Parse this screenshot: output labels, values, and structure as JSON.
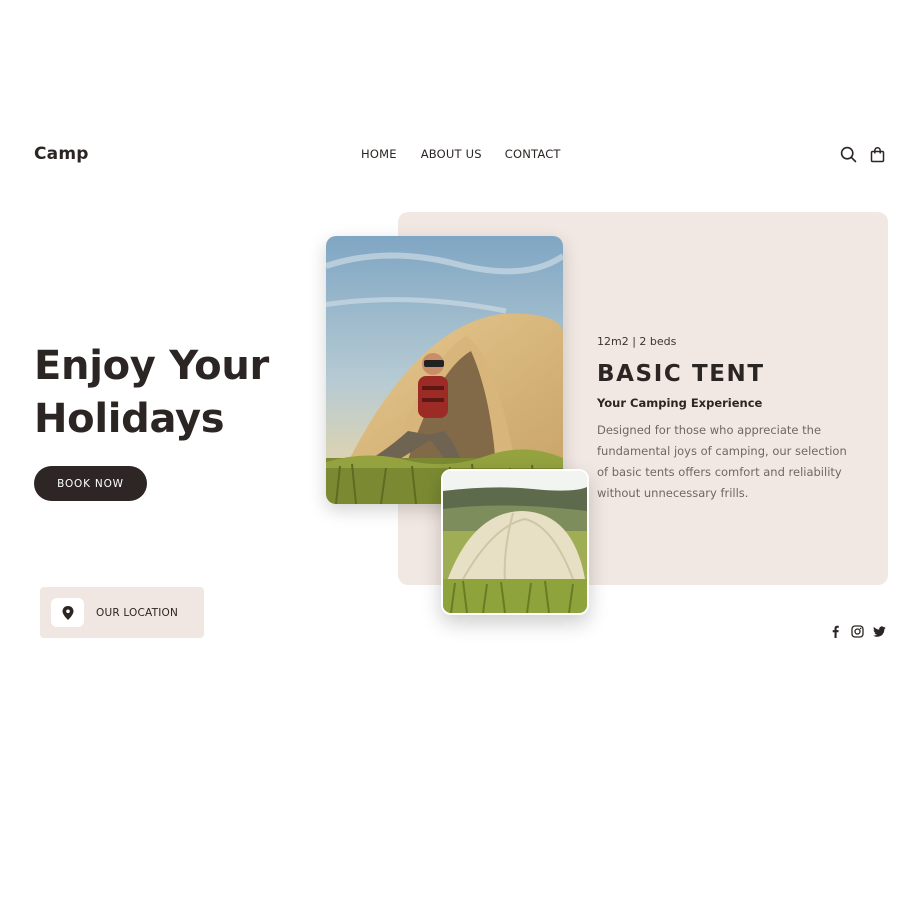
{
  "brand": {
    "logo": "Camp"
  },
  "nav": {
    "home": "HOME",
    "about": "ABOUT US",
    "contact": "CONTACT"
  },
  "header_icons": [
    "search-icon",
    "shopping-bag-icon"
  ],
  "hero": {
    "title_line1": "Enjoy Your",
    "title_line2": "Holidays",
    "cta": "BOOK NOW"
  },
  "location": {
    "label": "OUR LOCATION",
    "icon": "map-pin-icon"
  },
  "product": {
    "meta": "12m2 | 2 beds",
    "title": "BASIC TENT",
    "subtitle": "Your Camping Experience",
    "description": "Designed for those who appreciate the fundamental joys of camping, our selection of basic tents offers comfort and reliability without unnecessary frills."
  },
  "social": [
    "facebook-icon",
    "instagram-icon",
    "twitter-icon"
  ],
  "colors": {
    "dark": "#2d2624",
    "card_bg": "#f2e8e3",
    "text_muted": "#6f6764",
    "background": "#ffffff"
  }
}
